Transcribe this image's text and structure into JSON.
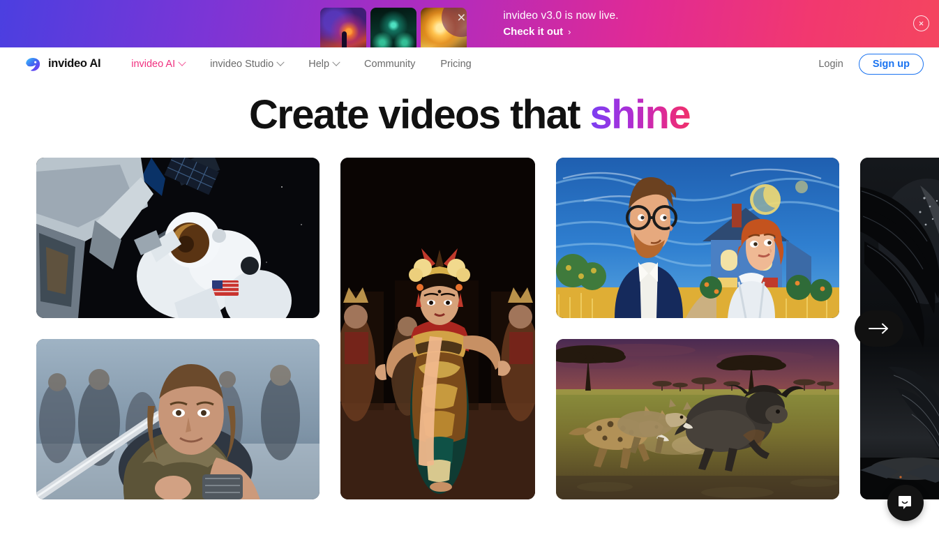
{
  "banner": {
    "title": "invideo v3.0 is now live.",
    "cta_label": "Check it out",
    "cta_chevron": "›",
    "close_icon_glyph": "×",
    "thumb_overlay_glyph": "×",
    "thumbnails": [
      {
        "name": "cosmic-portal-thumbnail"
      },
      {
        "name": "glowing-creature-thumbnail"
      },
      {
        "name": "golden-fire-thumbnail"
      }
    ],
    "gradient_start": "#4b3fe0",
    "gradient_mid": "#b22bbd",
    "gradient_end": "#f4455f"
  },
  "nav": {
    "brand": "invideo AI",
    "links": [
      {
        "label": "invideo AI",
        "has_dropdown": true,
        "active": true
      },
      {
        "label": "invideo Studio",
        "has_dropdown": true,
        "active": false
      },
      {
        "label": "Help",
        "has_dropdown": true,
        "active": false
      },
      {
        "label": "Community",
        "has_dropdown": false,
        "active": false
      },
      {
        "label": "Pricing",
        "has_dropdown": false,
        "active": false
      }
    ],
    "login_label": "Login",
    "signup_label": "Sign up",
    "active_color": "#f0307f",
    "signup_color": "#1a73f0"
  },
  "hero": {
    "headline_prefix": "Create videos that ",
    "headline_accent": "shine",
    "accent_gradient_start": "#7b3ff2",
    "accent_gradient_end": "#f0306a"
  },
  "gallery": {
    "next_label": "Next",
    "cards": [
      {
        "name": "astronaut-spacewalk",
        "caption": "Astronaut on a spacewalk beside a space station"
      },
      {
        "name": "viking-warrior-woman",
        "caption": "Warrior woman raising a sword in a snowy battlefield"
      },
      {
        "name": "balinese-dancer",
        "caption": "Balinese dancer in traditional gold costume on stage"
      },
      {
        "name": "illustrated-couple-house",
        "caption": "Van Gogh style illustrated couple before a blue house"
      },
      {
        "name": "savanna-hyenas-buffalo",
        "caption": "Hyenas chasing a cape buffalo at sunset on the savanna"
      },
      {
        "name": "dark-wings",
        "caption": "Dark feathered wings over a shadowy landscape"
      }
    ]
  },
  "chat": {
    "launcher_name": "intercom-chat-launcher"
  }
}
